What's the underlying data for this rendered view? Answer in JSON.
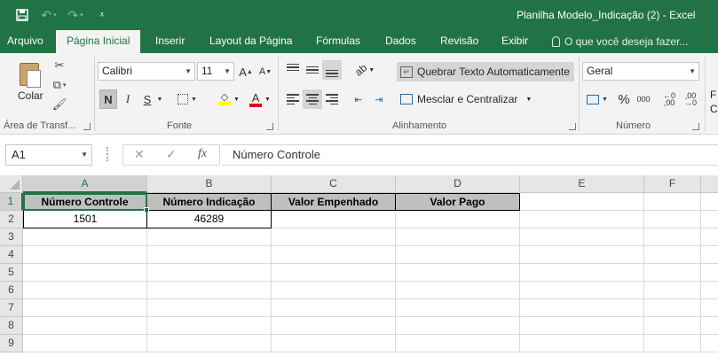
{
  "window": {
    "title": "Planilha Modelo_Indicação (2) - Excel"
  },
  "qat": {
    "icons": [
      "save-icon",
      "undo-icon",
      "redo-icon",
      "customize-icon"
    ]
  },
  "tabs": [
    {
      "label": "Arquivo"
    },
    {
      "label": "Página Inicial",
      "active": true
    },
    {
      "label": "Inserir"
    },
    {
      "label": "Layout da Página"
    },
    {
      "label": "Fórmulas"
    },
    {
      "label": "Dados"
    },
    {
      "label": "Revisão"
    },
    {
      "label": "Exibir"
    }
  ],
  "tell_me": {
    "placeholder": "O que você deseja fazer..."
  },
  "ribbon": {
    "clipboard": {
      "paste_label": "Colar",
      "group_label": "Área de Transf..."
    },
    "font": {
      "family": "Calibri",
      "size": "11",
      "group_label": "Fonte",
      "bold": "N",
      "italic": "I",
      "underline": "S",
      "grow": "A",
      "shrink": "A",
      "color_letter": "A"
    },
    "alignment": {
      "wrap_label": "Quebrar Texto Automaticamente",
      "merge_label": "Mesclar e Centralizar",
      "group_label": "Alinhamento"
    },
    "number": {
      "format": "Geral",
      "percent": "%",
      "thousands": "000",
      "group_label": "Número"
    },
    "next_group_edge": [
      "F",
      "C"
    ]
  },
  "formula_bar": {
    "name_box": "A1",
    "fx": "fx",
    "cancel": "✕",
    "enter": "✓",
    "formula": "Número Controle"
  },
  "sheet": {
    "columns": [
      "A",
      "B",
      "C",
      "D",
      "E",
      "F"
    ],
    "rows": [
      "1",
      "2",
      "3",
      "4",
      "5",
      "6",
      "7",
      "8",
      "9"
    ],
    "headers": [
      "Número Controle",
      "Número Indicação",
      "Valor Empenhado",
      "Valor Pago"
    ],
    "data_row": [
      "1501",
      "46289"
    ],
    "active_cell": "A1"
  }
}
